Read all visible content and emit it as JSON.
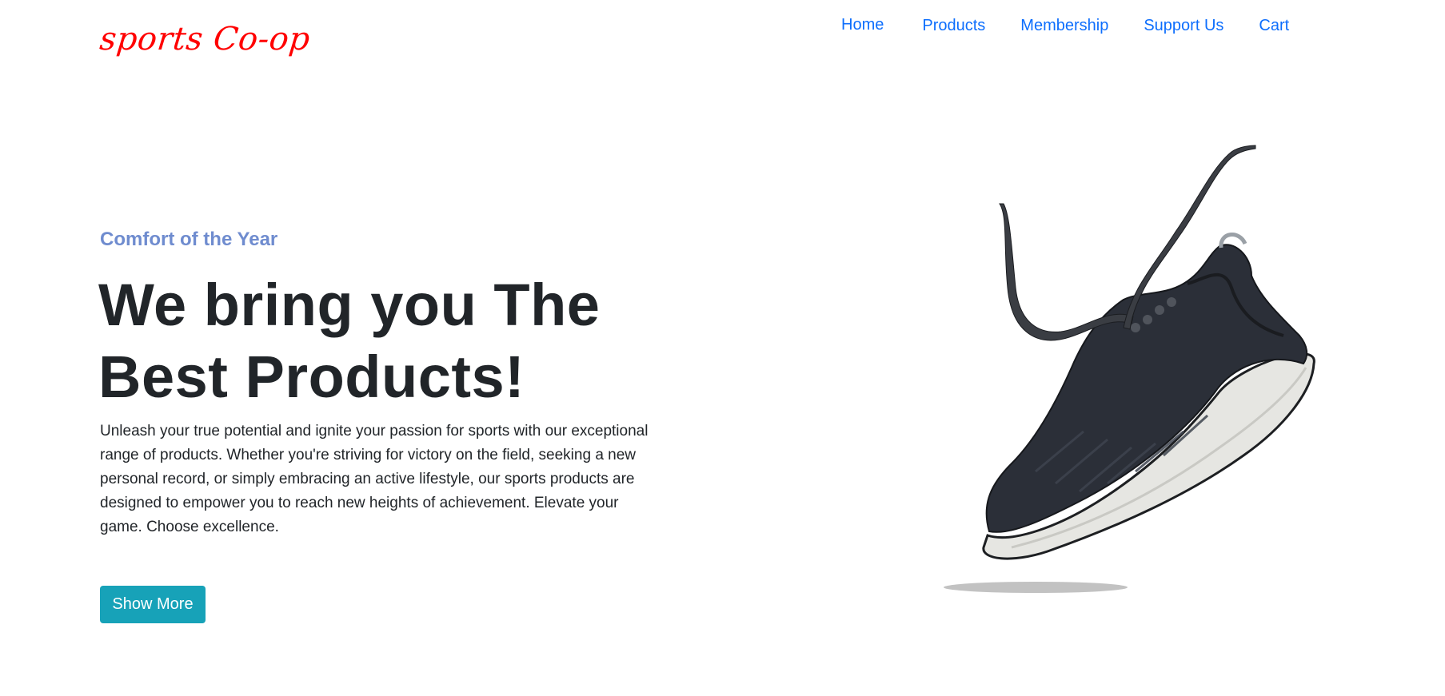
{
  "brand": {
    "name": "sports Co-op",
    "color": "#ff0000"
  },
  "nav": {
    "items": [
      {
        "label": "Home"
      },
      {
        "label": "Products"
      },
      {
        "label": "Membership"
      },
      {
        "label": "Support Us"
      },
      {
        "label": "Cart"
      }
    ],
    "link_color": "#0d6efd"
  },
  "hero": {
    "eyebrow": "Comfort of the Year",
    "headline_line1": "We bring you The",
    "headline_line2": "Best Products!",
    "description": "Unleash your true potential and ignite your passion for sports with our exceptional range of products. Whether you're striving for victory on the field, seeking a new personal record, or simply embracing an active lifestyle, our sports products are designed to empower you to reach new heights of achievement. Elevate your game. Choose excellence.",
    "cta_label": "Show More",
    "cta_color": "#17a2b8",
    "image_icon": "sneaker-icon"
  }
}
